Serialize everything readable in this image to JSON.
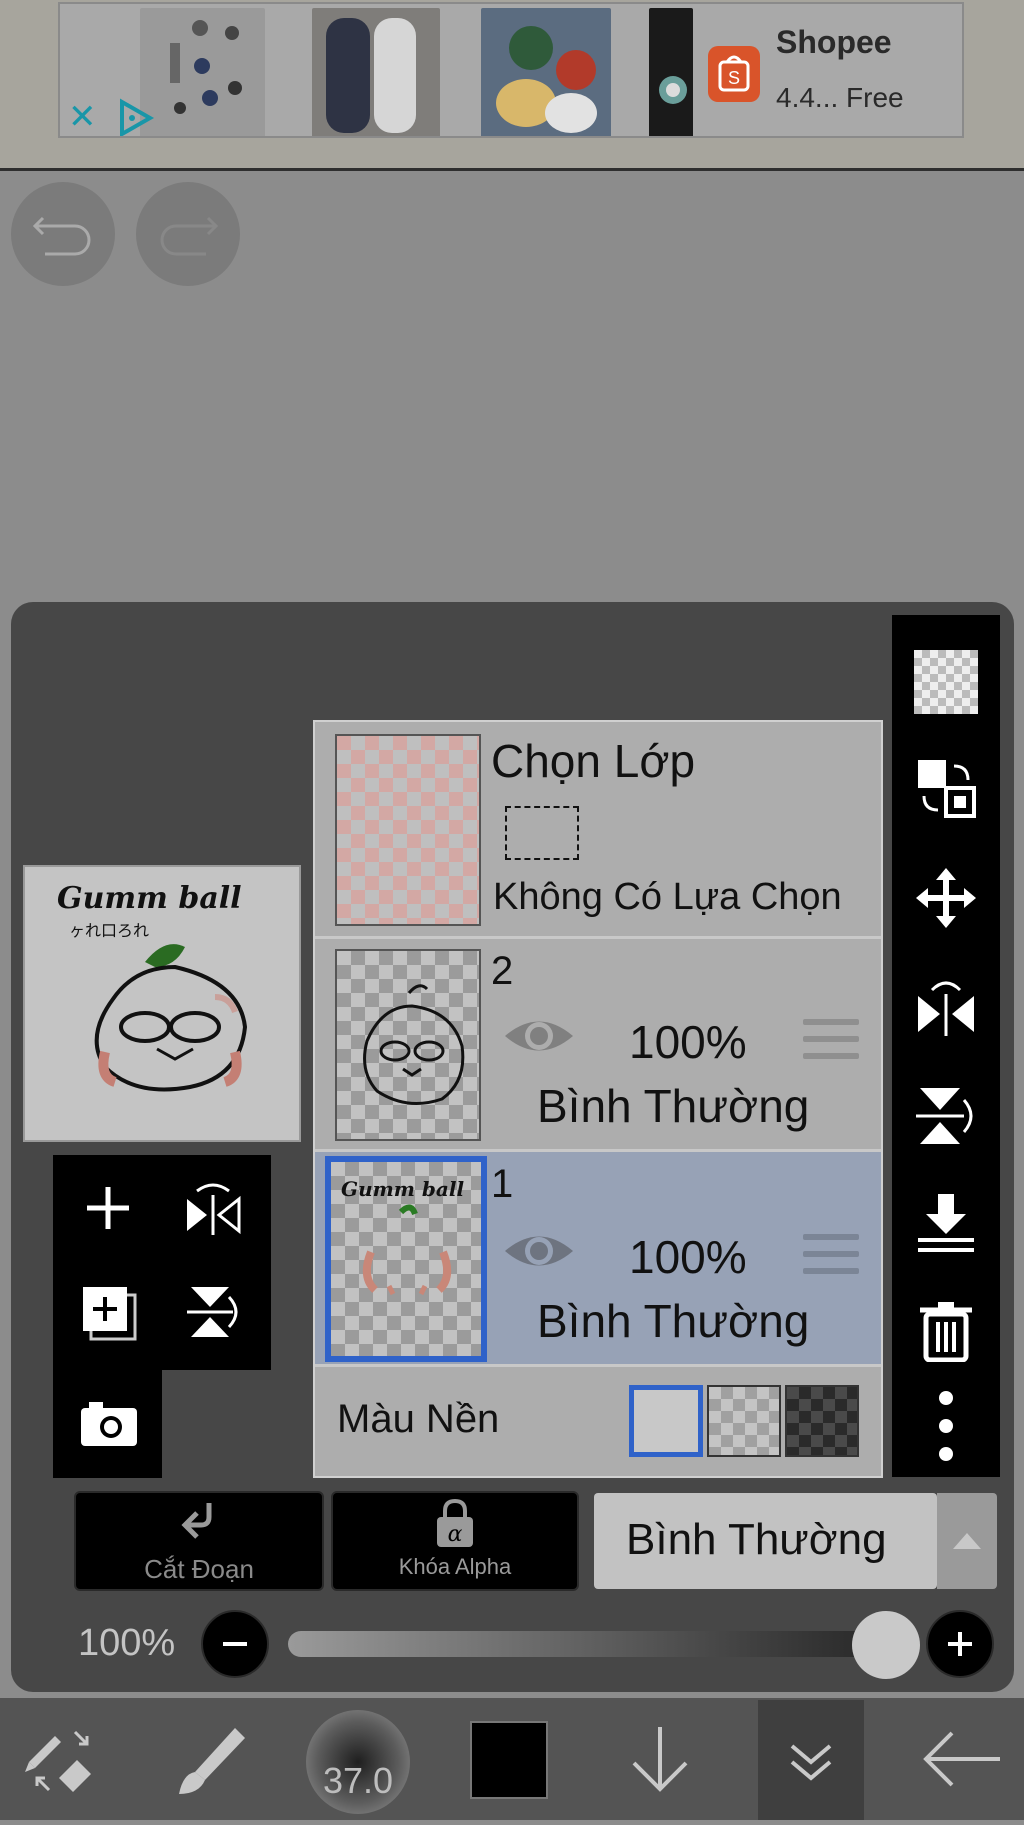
{
  "ad": {
    "title": "Shopee",
    "subtitle": "4.4... Free",
    "close_icon": "close-icon",
    "choices_icon": "ad-choices-icon"
  },
  "history": {
    "undo_icon": "undo-icon",
    "redo_icon": "redo-icon"
  },
  "layers_panel": {
    "selection_layer": {
      "label": "Chọn Lớp",
      "status": "Không Có Lựa Chọn"
    },
    "layers": [
      {
        "number": "2",
        "opacity": "100%",
        "blend": "Bình Thường",
        "selected": false
      },
      {
        "number": "1",
        "opacity": "100%",
        "blend": "Bình Thường",
        "selected": true
      }
    ],
    "background": {
      "label": "Màu Nền",
      "options": [
        "white",
        "checker-light",
        "checker-dark"
      ],
      "selected": "white"
    },
    "clip_button": "Cắt Đoạn",
    "alpha_lock_button": "Khóa Alpha",
    "blend_mode": "Bình Thường",
    "opacity_label": "100%",
    "opacity_value": 1.0
  },
  "preview": {
    "text_line1": "Gumm ball",
    "text_line2": "ヶれ口ろれ"
  },
  "bottom_toolbar": {
    "brush_size": "37.0",
    "current_color": "#000000"
  },
  "colors": {
    "panel_bg": "#474747",
    "selected_layer": "#97a2b6",
    "selection_blue": "#2f62c9",
    "toolbar_bg": "#000000"
  }
}
